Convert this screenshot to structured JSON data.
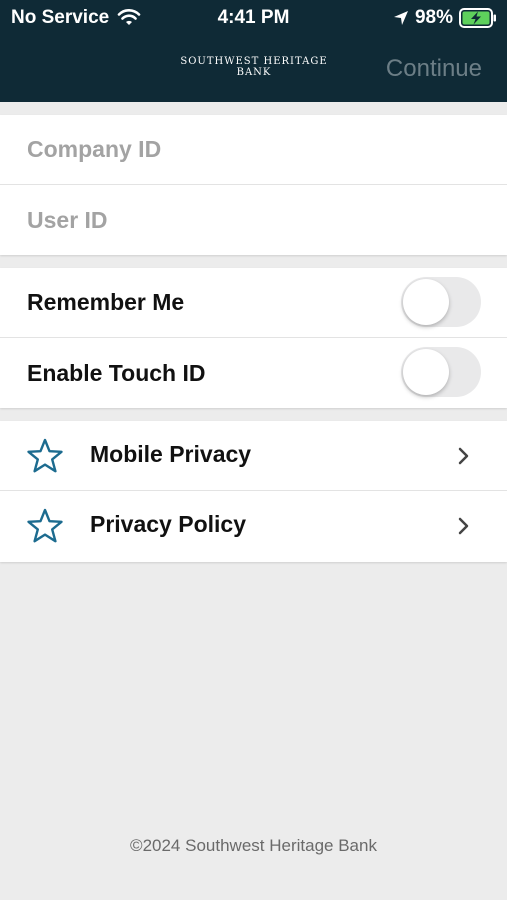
{
  "status_bar": {
    "carrier": "No Service",
    "time": "4:41 PM",
    "battery": "98%"
  },
  "header": {
    "logo_line1": "SOUTHWEST HERITAGE",
    "logo_line2": "BANK",
    "continue_label": "Continue"
  },
  "login": {
    "company_id_placeholder": "Company ID",
    "user_id_placeholder": "User ID"
  },
  "settings": {
    "remember_me": "Remember Me",
    "enable_touch_id": "Enable Touch ID"
  },
  "links": [
    {
      "label": "Mobile Privacy",
      "icon": "star-icon"
    },
    {
      "label": "Privacy Policy",
      "icon": "star-icon"
    }
  ],
  "footer": {
    "copyright": "©2024 Southwest Heritage Bank"
  },
  "colors": {
    "header_bg": "#0f2a36",
    "accent": "#1c6b8f"
  }
}
